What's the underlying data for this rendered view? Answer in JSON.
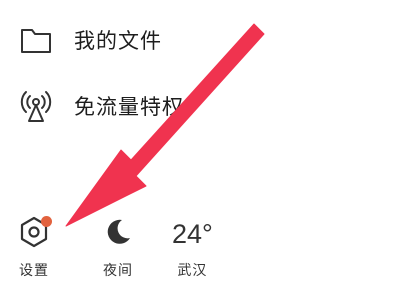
{
  "menu": {
    "items": [
      {
        "label": "我的文件",
        "icon": "folder-icon"
      },
      {
        "label": "免流量特权",
        "icon": "broadcast-tower-icon"
      }
    ]
  },
  "bottom_bar": {
    "settings": {
      "label": "设置",
      "icon": "settings-hexagon-icon",
      "has_badge": true
    },
    "night": {
      "label": "夜间",
      "icon": "moon-icon"
    },
    "weather": {
      "temperature": "24°",
      "city": "武汉"
    }
  },
  "colors": {
    "badge": "#e2623e",
    "annotation_arrow": "#f0334f",
    "icon_stroke": "#333333"
  }
}
